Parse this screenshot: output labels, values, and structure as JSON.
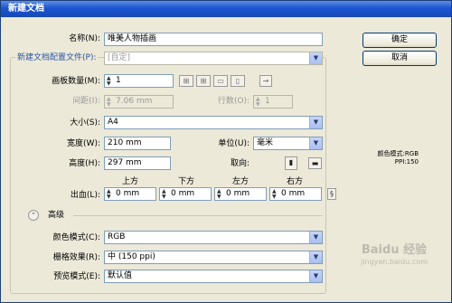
{
  "window": {
    "title": "新建文档"
  },
  "name_row": {
    "label": "名称(N):",
    "value": "唯美人物插画"
  },
  "profile_row": {
    "label": "新建文档配置文件(P):",
    "value": "[自定]"
  },
  "artboards": {
    "count_label": "画板数量(M):",
    "count_value": "1",
    "arrange_arrow": "→"
  },
  "spacing": {
    "label": "间距(I):",
    "value": "7.06 mm",
    "cols_label": "行数(O):",
    "cols_value": "1"
  },
  "size": {
    "label": "大小(S):",
    "value": "A4"
  },
  "width": {
    "label": "宽度(W):",
    "value": "210 mm"
  },
  "units": {
    "label": "单位(U):",
    "value": "毫米"
  },
  "height": {
    "label": "高度(H):",
    "value": "297 mm"
  },
  "orientation": {
    "label": "取向:"
  },
  "bleed": {
    "label": "出血(L):",
    "headers": [
      "上方",
      "下方",
      "左方",
      "右方"
    ],
    "values": [
      "0 mm",
      "0 mm",
      "0 mm",
      "0 mm"
    ]
  },
  "advanced": {
    "label": "高级"
  },
  "color_mode": {
    "label": "颜色模式(C):",
    "value": "RGB"
  },
  "raster": {
    "label": "栅格效果(R):",
    "value": "中 (150 ppi)"
  },
  "preview": {
    "label": "预览模式(E):",
    "value": "默认值"
  },
  "buttons": {
    "ok": "确定",
    "cancel": "取消"
  },
  "info_panel": {
    "line1": "颜色模式:RGB",
    "line2": "PPI:150"
  },
  "watermark": {
    "line1": "Baidu 经验",
    "line2": "jingyan.baidu.com"
  }
}
